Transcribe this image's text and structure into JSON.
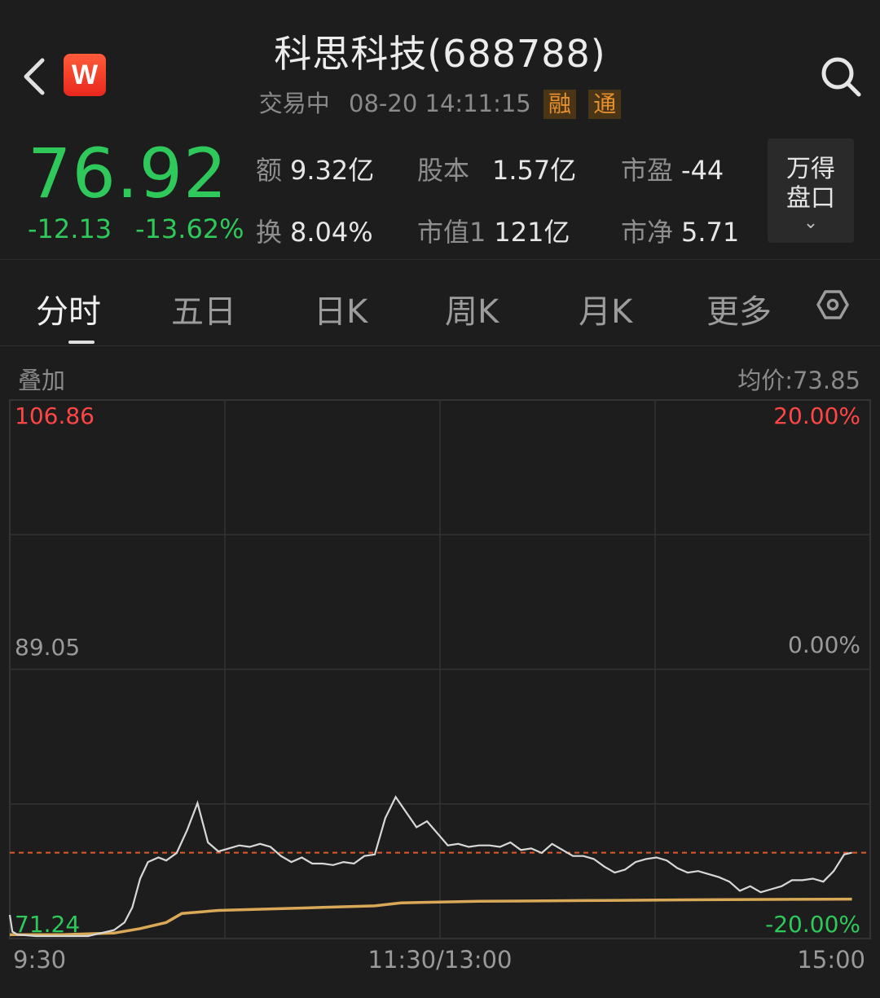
{
  "header": {
    "title": "科思科技(688788)",
    "status": "交易中",
    "datetime": "08-20 14:11:15",
    "tags": [
      "融",
      "通"
    ],
    "logo_text": "W"
  },
  "quote": {
    "price": "76.92",
    "change": "-12.13",
    "change_pct": "-13.62%",
    "stats": [
      {
        "label": "额",
        "value": "9.32亿"
      },
      {
        "label": "股本",
        "value": "1.57亿"
      },
      {
        "label": "市盈",
        "value": "-44"
      },
      {
        "label": "换",
        "value": "8.04%"
      },
      {
        "label": "市值1",
        "value": "121亿"
      },
      {
        "label": "市净",
        "value": "5.71"
      }
    ],
    "wind_button": {
      "line1": "万得",
      "line2": "盘口"
    }
  },
  "tabs": [
    "分时",
    "五日",
    "日K",
    "周K",
    "月K",
    "更多"
  ],
  "active_tab": 0,
  "chart_header": {
    "overlay_label": "叠加",
    "avg_price": "均价:73.85"
  },
  "chart_data": {
    "type": "line",
    "title": "",
    "y_price_labels": [
      "106.86",
      "89.05",
      "71.24"
    ],
    "y_pct_labels": [
      "20.00%",
      "0.00%",
      "-20.00%"
    ],
    "x_labels": [
      "9:30",
      "11:30/13:00",
      "15:00"
    ],
    "ylim": [
      71.24,
      106.86
    ],
    "reference_price": 76.92,
    "colors": {
      "price_line": "#d8d8d8",
      "avg_line": "#d9a957",
      "up": "#ff4545",
      "down": "#2fc95b",
      "ref_dashed": "#e05a2a"
    },
    "series": [
      {
        "values_by_minute": [
          [
            0,
            72.8
          ],
          [
            1,
            71.7
          ],
          [
            3,
            71.5
          ],
          [
            10,
            71.4
          ],
          [
            20,
            71.4
          ],
          [
            30,
            71.4
          ],
          [
            35,
            71.6
          ],
          [
            40,
            71.8
          ],
          [
            44,
            72.3
          ],
          [
            47,
            73.3
          ],
          [
            50,
            75.2
          ],
          [
            53,
            76.3
          ],
          [
            57,
            76.6
          ],
          [
            60,
            76.4
          ],
          [
            64,
            76.9
          ],
          [
            68,
            78.4
          ],
          [
            72,
            80.2
          ],
          [
            76,
            77.6
          ],
          [
            80,
            77.0
          ],
          [
            84,
            77.2
          ],
          [
            88,
            77.4
          ],
          [
            92,
            77.3
          ],
          [
            96,
            77.5
          ],
          [
            100,
            77.3
          ],
          [
            104,
            76.7
          ],
          [
            108,
            76.3
          ],
          [
            112,
            76.6
          ],
          [
            116,
            76.2
          ],
          [
            120,
            76.2
          ],
          [
            124,
            76.1
          ],
          [
            128,
            76.3
          ],
          [
            132,
            76.2
          ],
          [
            136,
            76.7
          ],
          [
            140,
            76.8
          ],
          [
            144,
            79.2
          ],
          [
            148,
            80.6
          ],
          [
            152,
            79.6
          ],
          [
            156,
            78.6
          ],
          [
            160,
            79.0
          ],
          [
            164,
            78.2
          ],
          [
            168,
            77.4
          ],
          [
            172,
            77.5
          ],
          [
            176,
            77.3
          ],
          [
            180,
            77.4
          ],
          [
            184,
            77.4
          ],
          [
            188,
            77.3
          ],
          [
            192,
            77.6
          ],
          [
            196,
            77.1
          ],
          [
            200,
            77.2
          ],
          [
            204,
            76.9
          ],
          [
            208,
            77.5
          ],
          [
            212,
            77.1
          ],
          [
            216,
            76.7
          ],
          [
            220,
            76.7
          ],
          [
            224,
            76.5
          ],
          [
            228,
            76.0
          ],
          [
            232,
            75.6
          ],
          [
            236,
            75.8
          ],
          [
            240,
            76.3
          ],
          [
            244,
            76.5
          ],
          [
            248,
            76.6
          ],
          [
            252,
            76.4
          ],
          [
            256,
            75.9
          ],
          [
            260,
            75.6
          ],
          [
            264,
            75.7
          ],
          [
            268,
            75.5
          ],
          [
            272,
            75.3
          ],
          [
            276,
            75.0
          ],
          [
            280,
            74.4
          ],
          [
            284,
            74.7
          ],
          [
            288,
            74.3
          ],
          [
            292,
            74.5
          ],
          [
            296,
            74.7
          ],
          [
            300,
            75.1
          ],
          [
            304,
            75.1
          ],
          [
            308,
            75.2
          ],
          [
            312,
            75.0
          ],
          [
            316,
            75.7
          ],
          [
            320,
            76.8
          ],
          [
            323,
            76.92
          ]
        ]
      },
      {
        "values_by_minute": [
          [
            0,
            71.5
          ],
          [
            20,
            71.5
          ],
          [
            40,
            71.6
          ],
          [
            50,
            71.9
          ],
          [
            60,
            72.3
          ],
          [
            66,
            72.9
          ],
          [
            80,
            73.1
          ],
          [
            120,
            73.3
          ],
          [
            140,
            73.4
          ],
          [
            150,
            73.6
          ],
          [
            180,
            73.7
          ],
          [
            220,
            73.75
          ],
          [
            260,
            73.8
          ],
          [
            300,
            73.83
          ],
          [
            323,
            73.85
          ]
        ]
      }
    ],
    "x_range_minutes": [
      0,
      240
    ]
  }
}
